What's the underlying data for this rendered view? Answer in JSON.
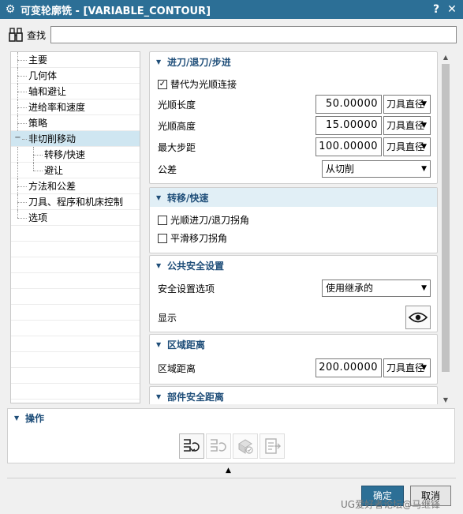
{
  "window": {
    "title": "可变轮廓铣 - [VARIABLE_CONTOUR]",
    "help_glyph": "?",
    "close_glyph": "✕"
  },
  "find": {
    "label": "查找",
    "value": ""
  },
  "tree": {
    "items": [
      {
        "label": "主要",
        "level": 0
      },
      {
        "label": "几何体",
        "level": 0
      },
      {
        "label": "轴和避让",
        "level": 0
      },
      {
        "label": "进给率和速度",
        "level": 0
      },
      {
        "label": "策略",
        "level": 0
      },
      {
        "label": "非切削移动",
        "level": 0,
        "selected": true,
        "expanded": true
      },
      {
        "label": "转移/快速",
        "level": 1
      },
      {
        "label": "避让",
        "level": 1
      },
      {
        "label": "方法和公差",
        "level": 0
      },
      {
        "label": "刀具、程序和机床控制",
        "level": 0
      },
      {
        "label": "选项",
        "level": 0
      }
    ]
  },
  "sections": {
    "engage": {
      "title": "进刀/退刀/步进",
      "smooth_checkbox": {
        "label": "替代为光顺连接",
        "checked": true
      },
      "smooth_length": {
        "label": "光顺长度",
        "value": "50.00000",
        "unit": "刀具直径"
      },
      "smooth_height": {
        "label": "光顺高度",
        "value": "15.00000",
        "unit": "刀具直径"
      },
      "max_step": {
        "label": "最大步距",
        "value": "100.00000",
        "unit": "刀具直径"
      },
      "tolerance": {
        "label": "公差",
        "value": "从切削"
      }
    },
    "transfer": {
      "title": "转移/快速",
      "smooth_corner": {
        "label": "光顺进刀/退刀拐角",
        "checked": false
      },
      "smooth_rapid": {
        "label": "平滑移刀拐角",
        "checked": false
      }
    },
    "common_safety": {
      "title": "公共安全设置",
      "option": {
        "label": "安全设置选项",
        "value": "使用继承的"
      },
      "display": {
        "label": "显示"
      }
    },
    "region_distance": {
      "title": "区域距离",
      "distance": {
        "label": "区域距离",
        "value": "200.00000",
        "unit": "刀具直径"
      }
    },
    "part_safety": {
      "title": "部件安全距离"
    }
  },
  "operations": {
    "title": "操作"
  },
  "buttons": {
    "ok": "确定",
    "cancel": "取消"
  },
  "watermark": "UG爱好者论坛@马继锋",
  "colors": {
    "titlebar": "#2c6f96",
    "section_title": "#1f4e79",
    "tree_selected": "#cfe6f1",
    "ok_button": "#2c6f96"
  }
}
